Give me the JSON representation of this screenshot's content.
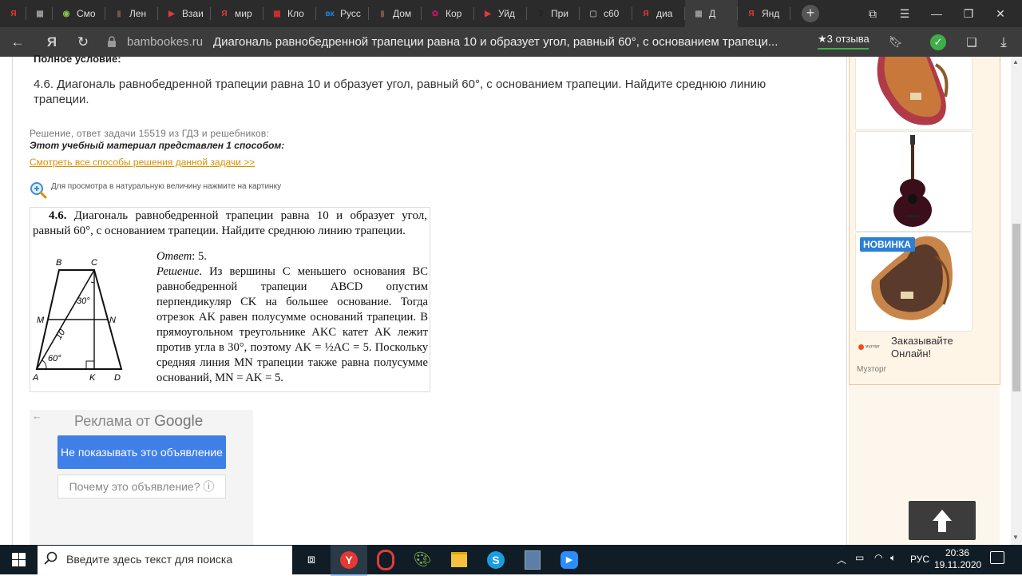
{
  "browser": {
    "tabs": [
      {
        "label": "Я",
        "color": "#e53935",
        "glyph": "Я"
      },
      {
        "label": "",
        "color": "#9e9e9e",
        "glyph": "▦"
      },
      {
        "label": "Смо",
        "color": "#8bc34a",
        "glyph": "◉"
      },
      {
        "label": "Лен",
        "color": "#795548",
        "glyph": "▮"
      },
      {
        "label": "Взаи",
        "color": "#e53935",
        "glyph": "▶"
      },
      {
        "label": "мир",
        "color": "#e53935",
        "glyph": "Я"
      },
      {
        "label": "Кло",
        "color": "#d32f2f",
        "glyph": "▦"
      },
      {
        "label": "Русс",
        "color": "#1e88e5",
        "glyph": "вк"
      },
      {
        "label": "Дом",
        "color": "#795548",
        "glyph": "▮"
      },
      {
        "label": "Кор",
        "color": "#c2185b",
        "glyph": "✿"
      },
      {
        "label": "Уйд",
        "color": "#e53935",
        "glyph": "▶"
      },
      {
        "label": "При",
        "color": "#212121",
        "glyph": "З"
      },
      {
        "label": "c60",
        "color": "#9e9e9e",
        "glyph": "▢"
      },
      {
        "label": "диа",
        "color": "#e53935",
        "glyph": "Я"
      },
      {
        "label": "Д",
        "color": "#9e9e9e",
        "glyph": "▦"
      },
      {
        "label": "Янд",
        "color": "#e53935",
        "glyph": "Я"
      }
    ],
    "new_tab": "+",
    "domain": "bambookes.ru",
    "title": "Диагональ равнобедренной трапеции равна 10 и образует угол, равный 60°, с основанием трапеци...",
    "reviews": "★3 отзыва"
  },
  "content": {
    "full_condition_label": "Полное условие:",
    "problem": "4.6. Диагональ равнобедренной трапеции равна 10 и образует угол, равный 60°, с основанием трапеции. Найдите среднюю линию трапеции.",
    "solution_source": "Решение, ответ задачи 15519 из ГДЗ и решебников:",
    "material_note": "Этот учебный материал представлен 1 способом:",
    "all_methods_link": "Смотреть все способы решения данной задачи >>",
    "zoom_hint": "Для просмотра в натуральную величину нажмите на картинку"
  },
  "scan": {
    "head_num": "4.6.",
    "head_text": " Диагональ равнобедренной трапеции равна 10 и образует угол, равный 60°, с основанием трапеции. Найдите среднюю линию трапеции.",
    "answer_label": "Ответ",
    "answer_value": ": 5.",
    "solution_label": "Решение",
    "solution_text": ". Из вершины C меньшего основания BC равнобедренной трапеции ABCD опустим перпендикуляр CK на большее основание. Тогда отрезок AK равен полусумме оснований трапеции. В прямоугольном треугольнике AKC катет AK лежит против угла в 30°, поэтому AK = ½AC = 5. Поскольку средняя линия MN трапеции также равна полусумме оснований, MN = AK = 5.",
    "figure_labels": {
      "B": "B",
      "C": "C",
      "M": "M",
      "N": "N",
      "A": "A",
      "K": "K",
      "D": "D",
      "angle30": "30°",
      "angle60": "60°",
      "diag": "10"
    }
  },
  "ad": {
    "back": "←",
    "title_prefix": "Реклама от ",
    "title_brand": "Google",
    "hide_button": "Не показывать это объявление",
    "why_button": "Почему это объявление? ⓘ"
  },
  "sidebar": {
    "new_badge": "НОВИНКА",
    "order_text": "Заказывайте Онлайн!",
    "brand_small": "Музторг",
    "brand_logo_text": "музторг"
  },
  "taskbar": {
    "search_placeholder": "Введите здесь текст для поиска",
    "lang": "РУС",
    "time": "20:36",
    "date": "19.11.2020"
  }
}
